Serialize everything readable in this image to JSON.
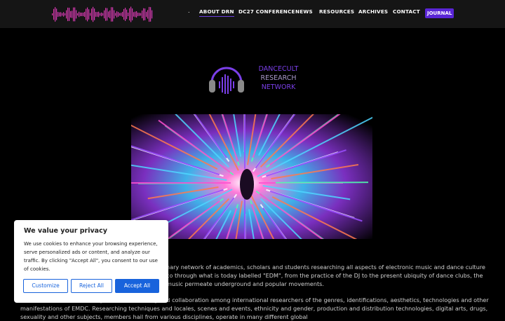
{
  "nav": {
    "dot": ".",
    "items": [
      {
        "label": "ABOUT DRN"
      },
      {
        "label": "DC27 CONFERENCE"
      },
      {
        "label": "NEWS"
      },
      {
        "label": "RESOURCES"
      },
      {
        "label": "ARCHIVES"
      },
      {
        "label": "CONTACT"
      }
    ],
    "journal_label": "JOURNAL",
    "active_item": "ABOUT DRN"
  },
  "brand": {
    "line1": "DANCECULT",
    "line2": "RESEARCH",
    "line3": "NETWORK",
    "accent": "#7a3fe8"
  },
  "content": {
    "paragraph1": "nary network of academics, scholars and students researching all aspects of electronic music and dance culture co through what is today labelled \"EDM\", from the practice of the DJ to the present ubiquity of dance clubs, the music permeate underground and popular movements.",
    "paragraph2": "cilitates information exchange, resource sharing and collaboration among international researchers of the genres, identifications, aesthetics, technologies and other manifestations of EMDC. Researching techniques and locales, scenes and events, ethnicity and gender, production and distribution technologies, digital arts, drugs, sexuality and other subjects, members hail from various disciplines, operate in many different global"
  },
  "cookie": {
    "title": "We value your privacy",
    "body": "We use cookies to enhance your browsing experience, serve personalized ads or content, and analyze our traffic. By clicking \"Accept All\", you consent to our use of cookies.",
    "customize_label": "Customize",
    "reject_label": "Reject All",
    "accept_label": "Accept All",
    "accent": "#1863dc"
  }
}
